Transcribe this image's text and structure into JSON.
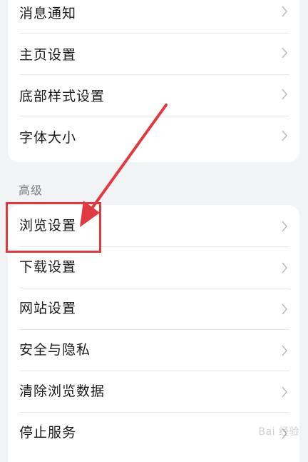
{
  "settings_top": {
    "items": [
      {
        "label": "消息通知"
      },
      {
        "label": "主页设置"
      },
      {
        "label": "底部样式设置"
      },
      {
        "label": "字体大小"
      }
    ]
  },
  "advanced": {
    "title": "高级",
    "items": [
      {
        "label": "浏览设置"
      },
      {
        "label": "下载设置"
      },
      {
        "label": "网站设置"
      },
      {
        "label": "安全与隐私"
      },
      {
        "label": "清除浏览数据"
      },
      {
        "label": "停止服务"
      }
    ]
  },
  "annotation": {
    "color": "#e0393f",
    "target": "浏览设置"
  },
  "watermark": {
    "text": "Bai 经验"
  }
}
